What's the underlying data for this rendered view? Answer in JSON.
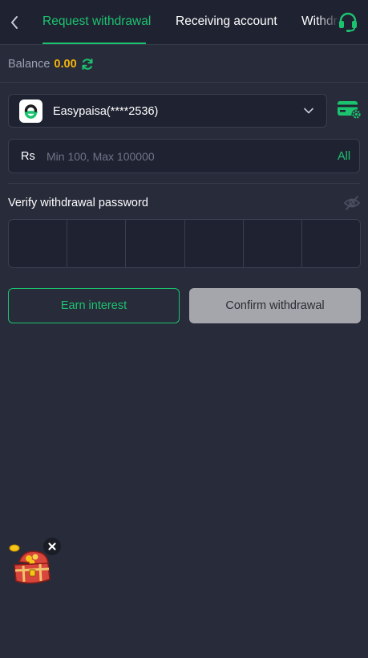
{
  "header": {
    "tabs": [
      {
        "label": "Request withdrawal",
        "active": true
      },
      {
        "label": "Receiving account",
        "active": false
      },
      {
        "label": "Withdrawal records",
        "active": false
      }
    ],
    "back_icon": "chevron-left-icon",
    "support_icon": "headset-icon"
  },
  "balance": {
    "label": "Balance",
    "value": "0.00",
    "refresh_icon": "refresh-icon"
  },
  "account": {
    "label": "Easypaisa(****2536)",
    "logo_icon": "easypaisa-logo-icon",
    "manage_icon": "card-settings-icon"
  },
  "amount": {
    "currency": "Rs",
    "placeholder": "Min 100, Max 100000",
    "all_label": "All"
  },
  "password": {
    "label": "Verify withdrawal password",
    "digits": 6,
    "visibility_icon": "eye-off-icon"
  },
  "buttons": {
    "earn_label": "Earn interest",
    "confirm_label": "Confirm withdrawal"
  },
  "colors": {
    "accent": "#1cc36f",
    "balance": "#f5b40a",
    "background": "#282b3a",
    "panel": "#1f2231",
    "disabled_button": "#a4a6ab"
  }
}
